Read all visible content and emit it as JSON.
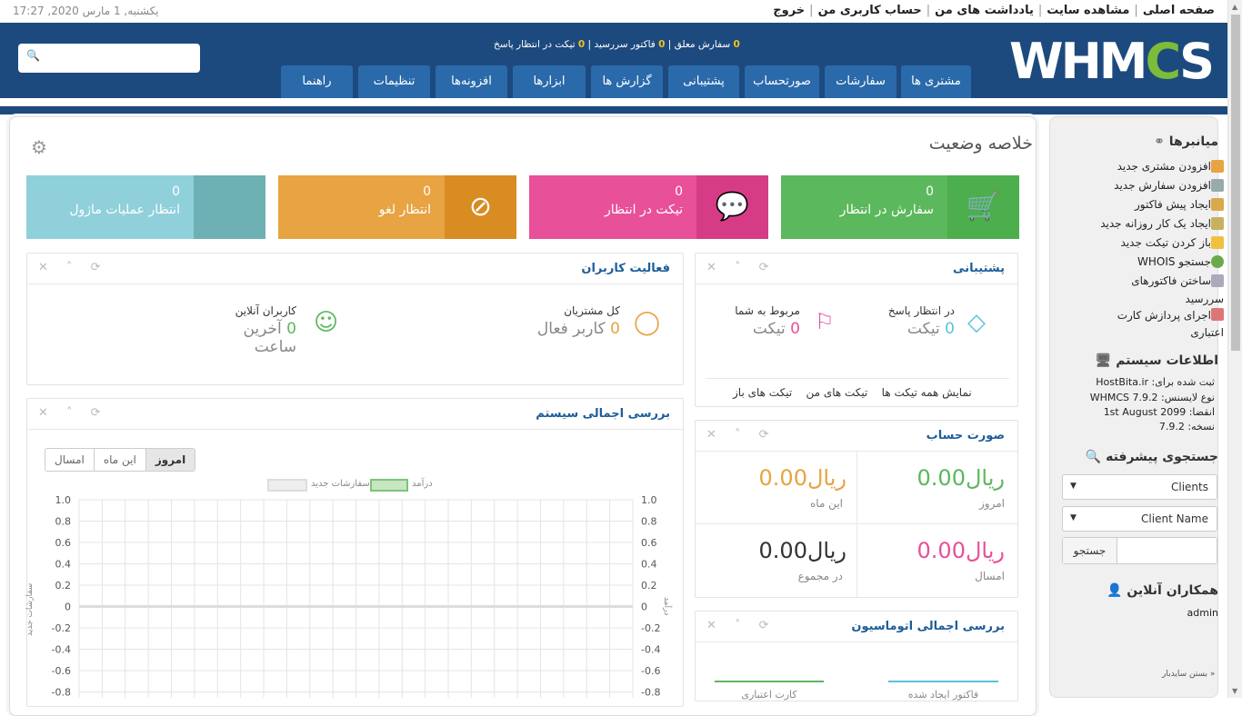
{
  "top": {
    "links": [
      "صفحه اصلی",
      "مشاهده سایت",
      "یادداشت های من",
      "حساب کاربری من",
      "خروج"
    ],
    "datetime": "یکشنبه, 1 مارس 2020, 17:27"
  },
  "header": {
    "logo": "WHMCS",
    "stats": {
      "pending_orders": "0",
      "pending_orders_label": "سفارش معلق",
      "overdue_invoices": "0",
      "overdue_invoices_label": "فاکتور سررسید",
      "awaiting_tickets": "0",
      "awaiting_tickets_label": "تیکت در انتظار پاسخ"
    },
    "search_placeholder": "",
    "nav": [
      "مشتری ها",
      "سفارشات",
      "صورتحساب",
      "پشتیبانی",
      "گزارش ها",
      "ابزارها",
      "افزونه‌ها",
      "تنظیمات",
      "راهنما"
    ]
  },
  "main": {
    "title": "خلاصه وضعیت",
    "boxes": [
      {
        "num": "0",
        "label": "سفارش در انتظار",
        "color": "#5cb85c",
        "icon": "cart-icon"
      },
      {
        "num": "0",
        "label": "تیکت در انتظار",
        "color": "#e8509a",
        "icon": "comment-icon"
      },
      {
        "num": "0",
        "label": "انتظار لغو",
        "color": "#e8a342",
        "icon": "ban-icon"
      },
      {
        "num": "0",
        "label": "انتظار عملیات ماژول",
        "color": "#8fd0db",
        "icon": "module-icon"
      }
    ],
    "support": {
      "title": "پشتیبانی",
      "awaiting_label": "در انتظار پاسخ",
      "awaiting_num": "0",
      "awaiting_unit": "تیکت",
      "assigned_label": "مربوط به شما",
      "assigned_num": "0",
      "assigned_unit": "تیکت",
      "links": [
        "نمایش همه تیکت ها",
        "تیکت های من",
        "تیکت های باز"
      ]
    },
    "activity": {
      "title": "فعالیت کاربران",
      "clients_label": "کل مشتریان",
      "clients_num": "0",
      "clients_unit": "کاربر فعال",
      "online_label": "کاربران آنلاین",
      "online_num": "0",
      "online_unit": "آخرین ساعت"
    },
    "billing": {
      "title": "صورت حساب",
      "today_val": "ریال0.00",
      "today_label": "امروز",
      "month_val": "ریال0.00",
      "month_label": "این ماه",
      "year_val": "ریال0.00",
      "year_label": "امسال",
      "total_val": "ریال0.00",
      "total_label": "در مجموع"
    },
    "overview": {
      "title": "بررسی اجمالی سیستم",
      "tabs": [
        "امروز",
        "این ماه",
        "امسال"
      ],
      "legend_income": "درآمد",
      "legend_orders": "سفارشات جدید",
      "y_left_label": "سفارشات جدید",
      "y_right_label": "درآمد"
    },
    "automation": {
      "title": "بررسی اجمالی اتوماسیون",
      "lbl1": "فاکتور ایجاد شده",
      "lbl2": "کارت اعتباری"
    }
  },
  "chart_data": {
    "type": "line",
    "title": "",
    "ylim": [
      -0.8,
      1.0
    ],
    "yticks": [
      "1.0",
      "0.8",
      "0.6",
      "0.4",
      "0.2",
      "0",
      "-0.2",
      "-0.4",
      "-0.6",
      "-0.8"
    ],
    "series": [
      {
        "name": "درآمد",
        "values": [
          0,
          0,
          0,
          0,
          0,
          0,
          0,
          0,
          0,
          0,
          0,
          0,
          0,
          0,
          0,
          0,
          0,
          0,
          0,
          0,
          0,
          0,
          0,
          0
        ]
      },
      {
        "name": "سفارشات جدید",
        "values": [
          0,
          0,
          0,
          0,
          0,
          0,
          0,
          0,
          0,
          0,
          0,
          0,
          0,
          0,
          0,
          0,
          0,
          0,
          0,
          0,
          0,
          0,
          0,
          0
        ]
      }
    ]
  },
  "sidebar": {
    "shortcuts_title": "میانبرها",
    "shortcuts": [
      "افزودن مشتری جدید",
      "افزودن سفارش جدید",
      "ایجاد پیش فاکتور",
      "ایجاد یک کار روزانه جدید",
      "باز کردن تیکت جدید",
      "جستجو WHOIS",
      "ساختن فاکتورهای",
      "سررسید",
      "اجرای پردازش کارت",
      "اعتباری"
    ],
    "sysinfo_title": "اطلاعات سیستم",
    "sysinfo": [
      "ثبت شده برای: HostBita.ir",
      "نوع لایسنس: WHMCS 7.9.2",
      "انقضا: 1st August 2099",
      "نسخه: 7.9.2"
    ],
    "search_title": "جستجوی پیشرفته",
    "select1": "Clients",
    "select2": "Client Name",
    "search_btn": "جستجو",
    "staff_title": "همکاران آنلاین",
    "staff_user": "admin",
    "close": "« بستن سایدبار"
  }
}
